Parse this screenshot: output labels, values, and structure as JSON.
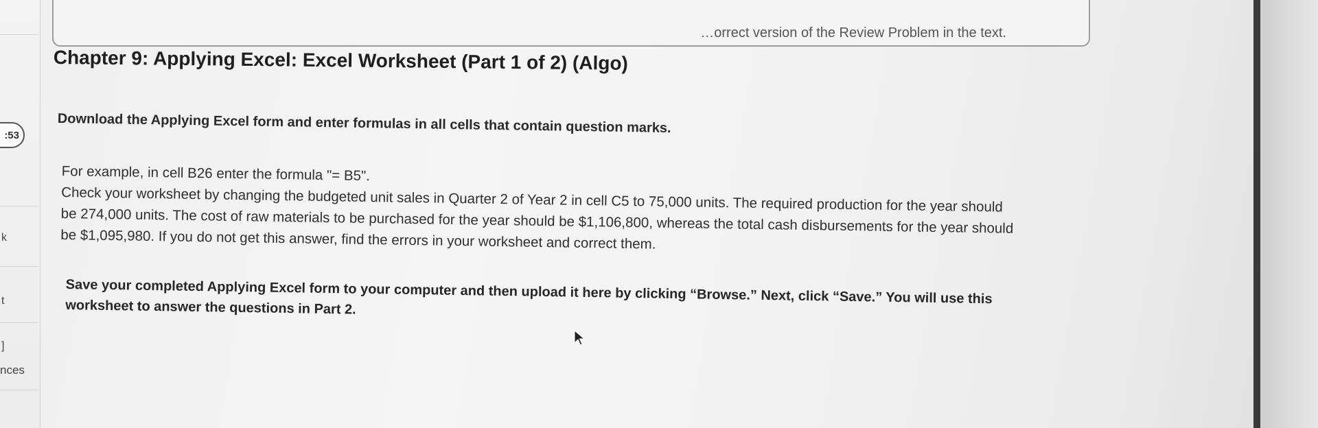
{
  "top_box": {
    "text": "…orrect version of the Review Problem in the text."
  },
  "title": "Chapter 9: Applying Excel: Excel Worksheet (Part 1 of 2) (Algo)",
  "sidebar": {
    "timer": ":53",
    "glyph_1": "k",
    "glyph_2": "t",
    "glyph_3": "]",
    "label": "nces"
  },
  "instructions": {
    "lead": "Download the Applying Excel form and enter formulas in all cells that contain question marks.",
    "example_lines": [
      "For example, in cell B26 enter the formula \"= B5\".",
      "Check your worksheet by changing the budgeted unit sales in Quarter 2 of Year 2 in cell C5 to 75,000 units. The required production for the year should",
      "be 274,000 units. The cost of raw materials to be purchased for the year should be $1,106,800, whereas the total cash disbursements for the year should",
      "be $1,095,980. If you do not get this answer, find the errors in your worksheet and correct them."
    ],
    "save_lines": [
      "Save your completed Applying Excel form to your computer and then upload it here by clicking “Browse.” Next, click “Save.” You will use this",
      "worksheet to answer the questions in Part 2."
    ]
  }
}
